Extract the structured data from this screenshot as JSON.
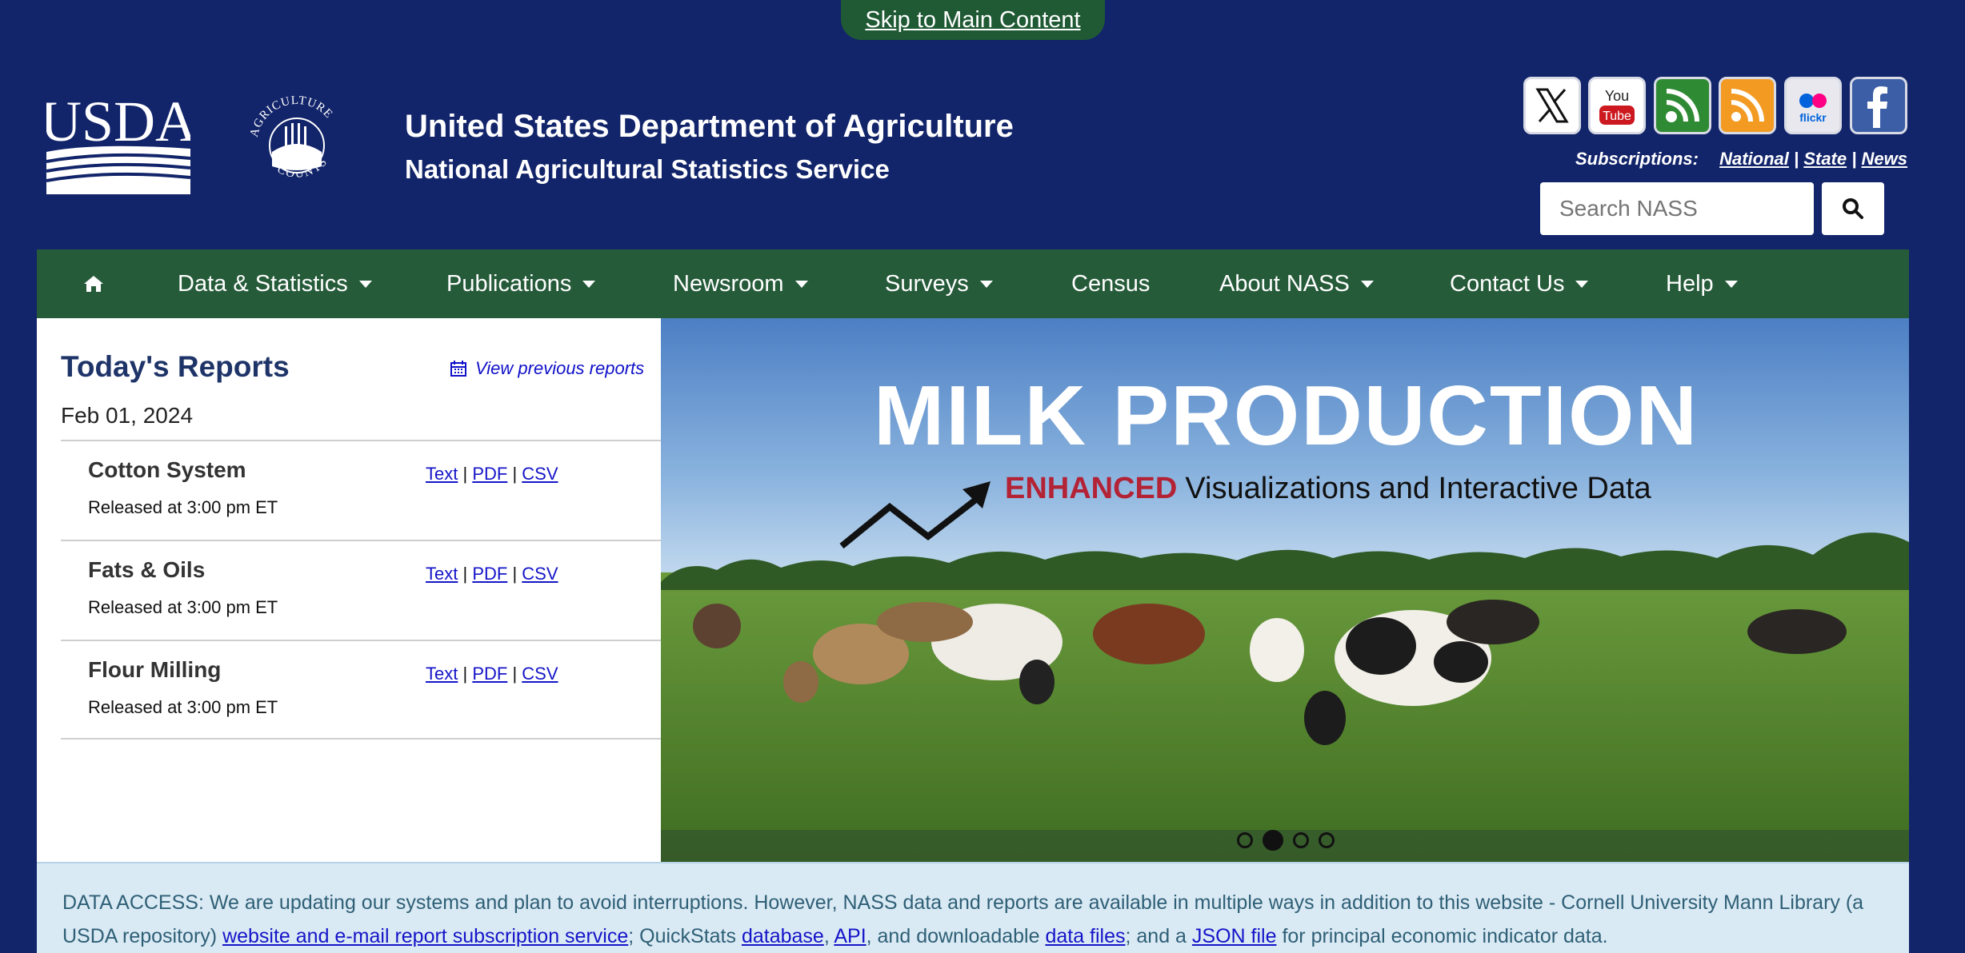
{
  "skip_link": "Skip to Main Content",
  "header": {
    "logo_text": "USDA",
    "seal_text": "AGRICULTURE COUNTS",
    "title": "United States Department of Agriculture",
    "subtitle": "National Agricultural Statistics Service"
  },
  "social": [
    {
      "name": "x-icon",
      "color": "#ffffff"
    },
    {
      "name": "youtube-icon",
      "color": "#cc181e"
    },
    {
      "name": "blog-icon",
      "color": "#2f8a34"
    },
    {
      "name": "rss-icon",
      "color": "#f39a22"
    },
    {
      "name": "flickr-icon",
      "color": "#0063dc"
    },
    {
      "name": "facebook-icon",
      "color": "#3c5ea6"
    }
  ],
  "subscriptions": {
    "label": "Subscriptions:",
    "national": "National",
    "sep1": "|",
    "state": "State",
    "sep2": "|",
    "news": "News"
  },
  "search": {
    "placeholder": "Search NASS",
    "icon": "search-icon"
  },
  "nav": {
    "home_icon": "home-icon",
    "items": [
      {
        "label": "Data & Statistics"
      },
      {
        "label": "Publications"
      },
      {
        "label": "Newsroom"
      },
      {
        "label": "Surveys"
      },
      {
        "label": "Census"
      },
      {
        "label": "About NASS"
      },
      {
        "label": "Contact Us"
      },
      {
        "label": "Help"
      }
    ]
  },
  "reports": {
    "title": "Today's Reports",
    "view_previous": "View previous reports",
    "date": "Feb 01, 2024",
    "items": [
      {
        "name": "Cotton System",
        "released": "Released at 3:00 pm ET",
        "text": "Text",
        "pdf": "PDF",
        "csv": "CSV",
        "sep": "|"
      },
      {
        "name": "Fats & Oils",
        "released": "Released at 3:00 pm ET",
        "text": "Text",
        "pdf": "PDF",
        "csv": "CSV",
        "sep": "|"
      },
      {
        "name": "Flour Milling",
        "released": "Released at 3:00 pm ET",
        "text": "Text",
        "pdf": "PDF",
        "csv": "CSV",
        "sep": "|"
      }
    ]
  },
  "hero": {
    "title": "MILK PRODUCTION",
    "enhanced": "ENHANCED",
    "subtitle": "Visualizations and Interactive Data",
    "slide_count": 4,
    "active_slide": 2
  },
  "notice": {
    "part1": "DATA ACCESS: We are updating our systems and plan to avoid interruptions. However, NASS data and reports are available in multiple ways in addition to this website - Cornell University Mann Library (a USDA repository) ",
    "link1": "website and e-mail report subscription service",
    "part2": "; QuickStats ",
    "link2": "database",
    "part3": ", ",
    "link3": "API",
    "part4": ", and downloadable ",
    "link4": "data files",
    "part5": "; and a ",
    "link5": "JSON file",
    "part6": " for principal economic indicator data."
  },
  "colors": {
    "header_bg": "#12246a",
    "nav_bg": "#265b3a",
    "notice_bg": "#daeaf4",
    "link": "#1515c8",
    "enhanced": "#b32235"
  }
}
